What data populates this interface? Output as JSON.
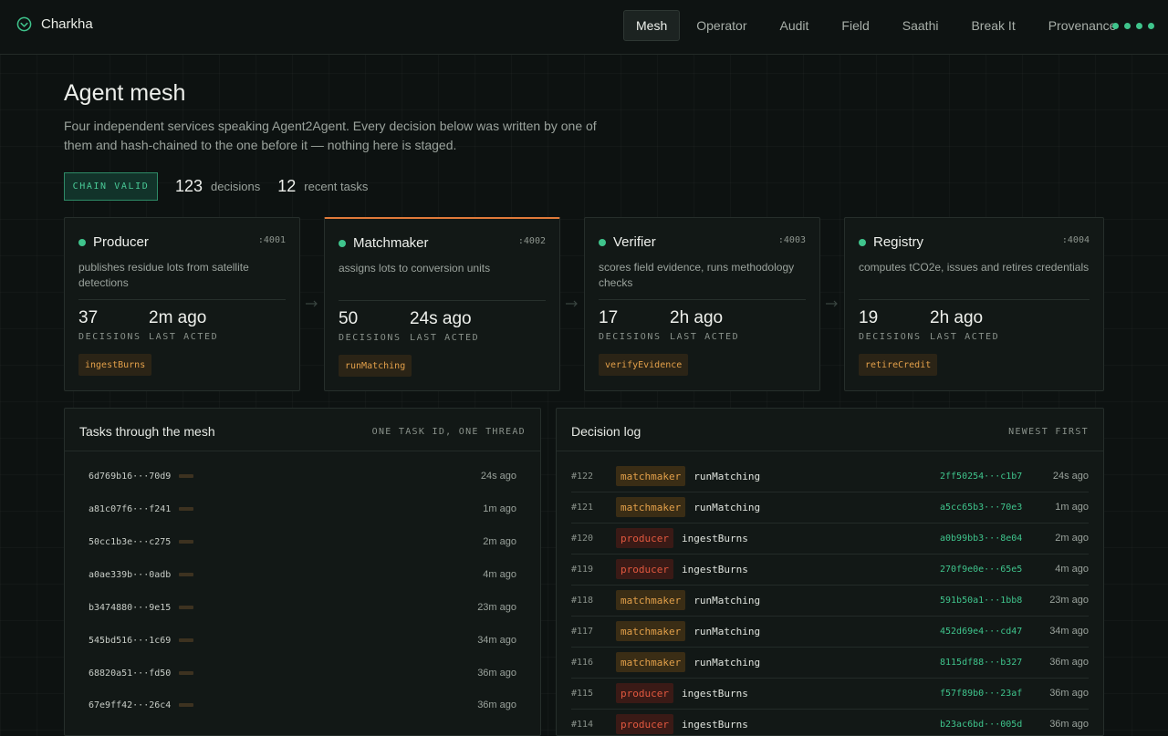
{
  "app": {
    "name": "Charkha",
    "nav": [
      {
        "label": "Mesh",
        "active": true
      },
      {
        "label": "Operator",
        "active": false
      },
      {
        "label": "Audit",
        "active": false
      },
      {
        "label": "Field",
        "active": false
      },
      {
        "label": "Saathi",
        "active": false
      },
      {
        "label": "Break It",
        "active": false
      },
      {
        "label": "Provenance",
        "active": false
      }
    ],
    "accent": "#3fc48c"
  },
  "header": {
    "title": "Agent mesh",
    "description": "Four independent services speaking Agent2Agent. Every decision below was written by one of them and hash-chained to the one before it — nothing here is staged."
  },
  "stats": {
    "chain_status": "CHAIN VALID",
    "decisions_count": "123",
    "decisions_label": "decisions",
    "tasks_count": "12",
    "tasks_label": "recent tasks"
  },
  "agents": [
    {
      "name": "Producer",
      "port": ":4001",
      "description": "publishes residue lots from satellite detections",
      "decisions": "37",
      "decisions_label": "DECISIONS",
      "last_acted": "2m ago",
      "last_acted_label": "LAST ACTED",
      "skill": "ingestBurns"
    },
    {
      "name": "Matchmaker",
      "port": ":4002",
      "description": "assigns lots to conversion units",
      "decisions": "50",
      "decisions_label": "DECISIONS",
      "last_acted": "24s ago",
      "last_acted_label": "LAST ACTED",
      "skill": "runMatching"
    },
    {
      "name": "Verifier",
      "port": ":4003",
      "description": "scores field evidence, runs methodology checks",
      "decisions": "17",
      "decisions_label": "DECISIONS",
      "last_acted": "2h ago",
      "last_acted_label": "LAST ACTED",
      "skill": "verifyEvidence"
    },
    {
      "name": "Registry",
      "port": ":4004",
      "description": "computes tCO2e, issues and retires credentials",
      "decisions": "19",
      "decisions_label": "DECISIONS",
      "last_acted": "2h ago",
      "last_acted_label": "LAST ACTED",
      "skill": "retireCredit"
    }
  ],
  "tasks_panel": {
    "title": "Tasks through the mesh",
    "subtitle": "ONE TASK ID, ONE THREAD",
    "tasks": [
      {
        "id": "6d769b16···70d9",
        "time": "24s ago"
      },
      {
        "id": "a81c07f6···f241",
        "time": "1m ago"
      },
      {
        "id": "50cc1b3e···c275",
        "time": "2m ago"
      },
      {
        "id": "a0ae339b···0adb",
        "time": "4m ago"
      },
      {
        "id": "b3474880···9e15",
        "time": "23m ago"
      },
      {
        "id": "545bd516···1c69",
        "time": "34m ago"
      },
      {
        "id": "68820a51···fd50",
        "time": "36m ago"
      },
      {
        "id": "67e9ff42···26c4",
        "time": "36m ago"
      }
    ]
  },
  "log_panel": {
    "title": "Decision log",
    "subtitle": "NEWEST FIRST",
    "entries": [
      {
        "num": "#122",
        "role": "matchmaker",
        "action": "runMatching",
        "hash": "2ff50254···c1b7",
        "time": "24s ago"
      },
      {
        "num": "#121",
        "role": "matchmaker",
        "action": "runMatching",
        "hash": "a5cc65b3···70e3",
        "time": "1m ago"
      },
      {
        "num": "#120",
        "role": "producer",
        "action": "ingestBurns",
        "hash": "a0b99bb3···8e04",
        "time": "2m ago"
      },
      {
        "num": "#119",
        "role": "producer",
        "action": "ingestBurns",
        "hash": "270f9e0e···65e5",
        "time": "4m ago"
      },
      {
        "num": "#118",
        "role": "matchmaker",
        "action": "runMatching",
        "hash": "591b50a1···1bb8",
        "time": "23m ago"
      },
      {
        "num": "#117",
        "role": "matchmaker",
        "action": "runMatching",
        "hash": "452d69e4···cd47",
        "time": "34m ago"
      },
      {
        "num": "#116",
        "role": "matchmaker",
        "action": "runMatching",
        "hash": "8115df88···b327",
        "time": "36m ago"
      },
      {
        "num": "#115",
        "role": "producer",
        "action": "ingestBurns",
        "hash": "f57f89b0···23af",
        "time": "36m ago"
      },
      {
        "num": "#114",
        "role": "producer",
        "action": "ingestBurns",
        "hash": "b23ac6bd···005d",
        "time": "36m ago"
      }
    ]
  }
}
